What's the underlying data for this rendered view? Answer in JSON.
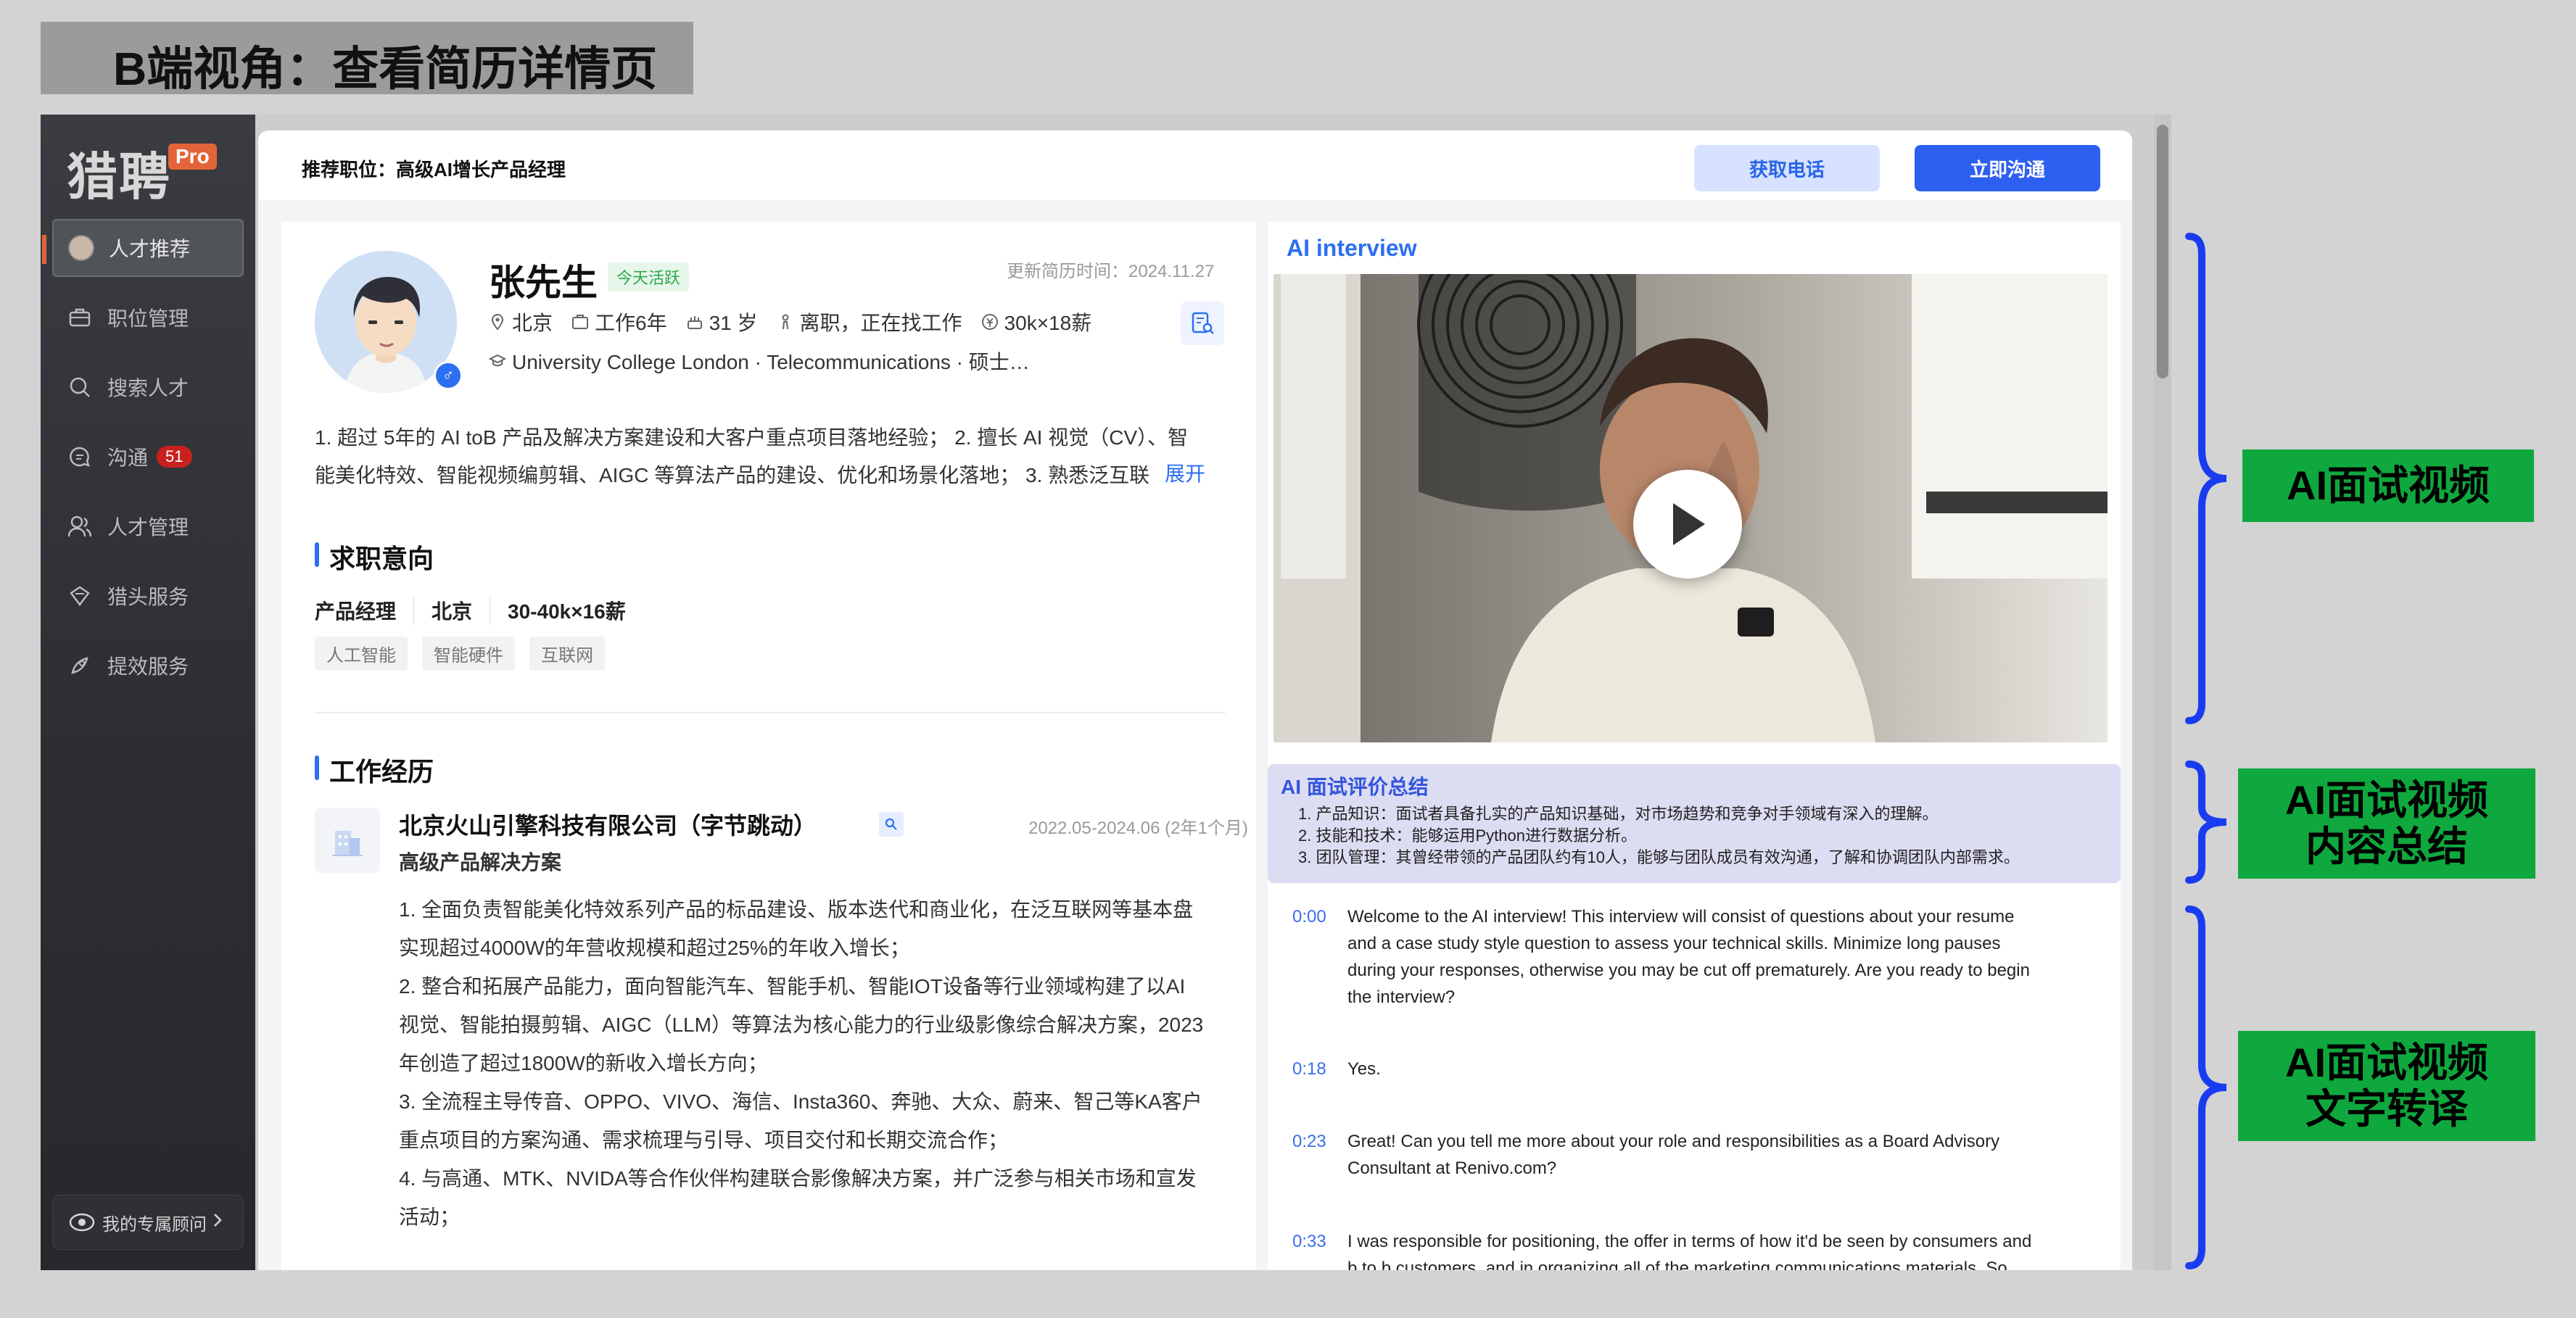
{
  "slide": {
    "title": "B端视角：查看简历详情页"
  },
  "sidebar": {
    "logo": "猎聘",
    "logo_badge": "Pro",
    "items": [
      {
        "label": "人才推荐",
        "icon": "avatar"
      },
      {
        "label": "职位管理",
        "icon": "briefcase-icon"
      },
      {
        "label": "搜索人才",
        "icon": "search-icon"
      },
      {
        "label": "沟通",
        "icon": "chat-icon",
        "badge": "51"
      },
      {
        "label": "人才管理",
        "icon": "users-icon"
      },
      {
        "label": "猎头服务",
        "icon": "shield-icon"
      },
      {
        "label": "提效服务",
        "icon": "rocket-icon"
      }
    ],
    "advisor": "我的专属顾问"
  },
  "header": {
    "job": "推荐职位：高级AI增长产品经理",
    "phone_btn": "获取电话",
    "chat_btn": "立即沟通"
  },
  "candidate": {
    "name": "张先生",
    "active": "今天活跃",
    "updated": "更新简历时间：2024.11.27",
    "city": "北京",
    "experience": "工作6年",
    "age": "31 岁",
    "status": "离职，正在找工作",
    "salary": "30k×18薪",
    "education": "University College London · Telecommunications · 硕士…",
    "summary_lines": [
      "1. 超过 5年的 AI toB 产品及解决方案建设和大客户重点项目落地经验； 2. 擅长 AI 视觉（CV）、智",
      "能美化特效、智能视频编剪辑、AIGC 等算法产品的建设、优化和场景化落地； 3. 熟悉泛互联"
    ],
    "expand": "展开"
  },
  "intent": {
    "heading": "求职意向",
    "position": "产品经理",
    "city": "北京",
    "salary": "30-40k×16薪",
    "tags": [
      "人工智能",
      "智能硬件",
      "互联网"
    ]
  },
  "work": {
    "heading": "工作经历",
    "company": "北京火山引擎科技有限公司（字节跳动）",
    "period": "2022.05-2024.06 (2年1个月)",
    "role": "高级产品解决方案",
    "duties": [
      "1. 全面负责智能美化特效系列产品的标品建设、版本迭代和商业化，在泛互联网等基本盘",
      "实现超过4000W的年营收规模和超过25%的年收入增长；",
      "2. 整合和拓展产品能力，面向智能汽车、智能手机、智能IOT设备等行业领域构建了以AI",
      "视觉、智能拍摄剪辑、AIGC（LLM）等算法为核心能力的行业级影像综合解决方案，2023",
      "年创造了超过1800W的新收入增长方向；",
      "3. 全流程主导传音、OPPO、VIVO、海信、Insta360、奔驰、大众、蔚来、智己等KA客户",
      "重点项目的方案沟通、需求梳理与引导、项目交付和长期交流合作；",
      "4. 与高通、MTK、NVIDA等合作伙伴构建联合影像解决方案，并广泛参与相关市场和宣发",
      "活动；"
    ]
  },
  "ai": {
    "title": "AI interview",
    "summary_title": "AI 面试评价总结",
    "summary_items": [
      "1. 产品知识：面试者具备扎实的产品知识基础，对市场趋势和竞争对手领域有深入的理解。",
      "2. 技能和技术：能够运用Python进行数据分析。",
      "3. 团队管理：其曾经带领的产品团队约有10人，能够与团队成员有效沟通，了解和协调团队内部需求。"
    ],
    "transcript": [
      {
        "time": "0:00",
        "lines": [
          "Welcome to the AI interview! This interview will consist of questions about your resume",
          "and a case study style question to assess your technical skills. Minimize long pauses",
          "during your responses, otherwise you may be cut off prematurely. Are you ready to begin",
          "the interview?"
        ]
      },
      {
        "time": "0:18",
        "lines": [
          "Yes."
        ]
      },
      {
        "time": "0:23",
        "lines": [
          "Great! Can you tell me more about your role and responsibilities as a Board Advisory",
          "Consultant at Renivo.com?"
        ]
      },
      {
        "time": "0:33",
        "lines": [
          "I was responsible for positioning, the offer in terms of how it'd be seen by consumers and",
          "b to b customers, and in organizing all of the marketing communications materials. So"
        ]
      }
    ]
  },
  "annotations": {
    "video": "AI面试视频",
    "summary": [
      "AI面试视频",
      "内容总结"
    ],
    "transcript": [
      "AI面试视频",
      "文字转译"
    ]
  },
  "colors": {
    "accent": "#2d6ff0",
    "annotation_green": "#0fa83e",
    "brace_blue": "#1a3cf0"
  }
}
